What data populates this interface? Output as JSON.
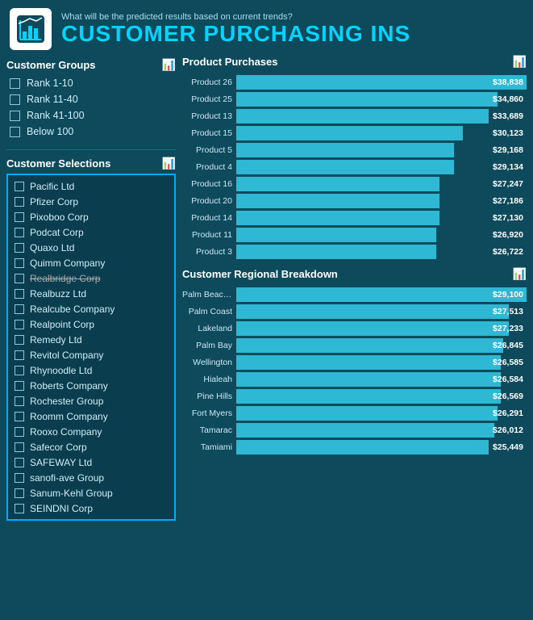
{
  "header": {
    "subtitle": "What will be the predicted results based on current trends?",
    "title": "CUSTOMER PURCHASING INS"
  },
  "left": {
    "groups_title": "Customer Groups",
    "groups": [
      {
        "label": "Rank 1-10"
      },
      {
        "label": "Rank 11-40"
      },
      {
        "label": "Rank 41-100"
      },
      {
        "label": "Below 100"
      }
    ],
    "selections_title": "Customer Selections",
    "customers": [
      {
        "label": "Pacific Ltd"
      },
      {
        "label": "Pfizer Corp"
      },
      {
        "label": "Pixoboo Corp"
      },
      {
        "label": "Podcat Corp"
      },
      {
        "label": "Quaxo Ltd"
      },
      {
        "label": "Quimm Company"
      },
      {
        "label": "Realbridge Corp",
        "dim": true
      },
      {
        "label": "Realbuzz Ltd"
      },
      {
        "label": "Realcube Company"
      },
      {
        "label": "Realpoint Corp"
      },
      {
        "label": "Remedy Ltd"
      },
      {
        "label": "Revitol Company"
      },
      {
        "label": "Rhynoodle Ltd"
      },
      {
        "label": "Roberts Company"
      },
      {
        "label": "Rochester Group"
      },
      {
        "label": "Roomm Company"
      },
      {
        "label": "Rooxo Company"
      },
      {
        "label": "Safecor Corp"
      },
      {
        "label": "SAFEWAY Ltd"
      },
      {
        "label": "sanofi-ave Group"
      },
      {
        "label": "Sanum-Kehl Group"
      },
      {
        "label": "SEINDNI Corp"
      }
    ]
  },
  "product_purchases": {
    "title": "Product Purchases",
    "bars": [
      {
        "label": "Product 26",
        "value": "$38,838",
        "pct": 100
      },
      {
        "label": "Product 25",
        "value": "$34,860",
        "pct": 90
      },
      {
        "label": "Product 13",
        "value": "$33,689",
        "pct": 87
      },
      {
        "label": "Product 15",
        "value": "$30,123",
        "pct": 78
      },
      {
        "label": "Product 5",
        "value": "$29,168",
        "pct": 75
      },
      {
        "label": "Product 4",
        "value": "$29,134",
        "pct": 75
      },
      {
        "label": "Product 16",
        "value": "$27,247",
        "pct": 70
      },
      {
        "label": "Product 20",
        "value": "$27,186",
        "pct": 70
      },
      {
        "label": "Product 14",
        "value": "$27,130",
        "pct": 70
      },
      {
        "label": "Product 11",
        "value": "$26,920",
        "pct": 69
      },
      {
        "label": "Product 3",
        "value": "$26,722",
        "pct": 69
      }
    ]
  },
  "regional_breakdown": {
    "title": "Customer Regional Breakdown",
    "bars": [
      {
        "label": "Palm Beach G...",
        "value": "$29,100",
        "pct": 100
      },
      {
        "label": "Palm Coast",
        "value": "$27,513",
        "pct": 94
      },
      {
        "label": "Lakeland",
        "value": "$27,233",
        "pct": 94
      },
      {
        "label": "Palm Bay",
        "value": "$26,845",
        "pct": 92
      },
      {
        "label": "Wellington",
        "value": "$26,585",
        "pct": 91
      },
      {
        "label": "Hialeah",
        "value": "$26,584",
        "pct": 91
      },
      {
        "label": "Pine Hills",
        "value": "$26,569",
        "pct": 91
      },
      {
        "label": "Fort Myers",
        "value": "$26,291",
        "pct": 90
      },
      {
        "label": "Tamarac",
        "value": "$26,012",
        "pct": 89
      },
      {
        "label": "Tamiami",
        "value": "$25,449",
        "pct": 87
      }
    ]
  },
  "icons": {
    "chart": "📊",
    "header_icon_label": "chart-icon"
  }
}
